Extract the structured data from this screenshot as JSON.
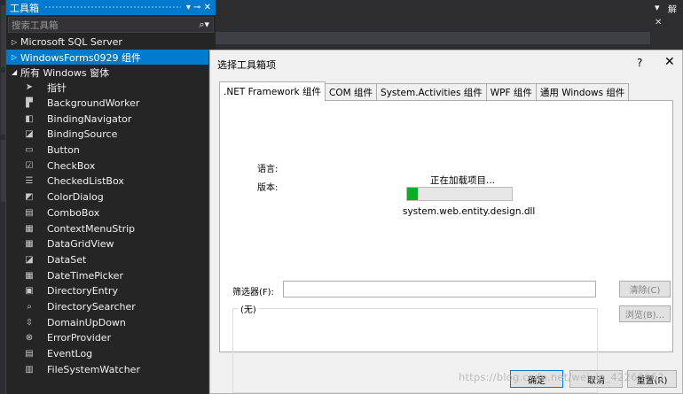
{
  "toolbox": {
    "title": "工具箱",
    "controls": "▾ ⊸ ✕",
    "search_placeholder": "搜索工具箱",
    "search_icon_glyph": "⌕▾",
    "groups": [
      {
        "label": "Microsoft SQL Server",
        "expanded": false,
        "selected": false
      },
      {
        "label": "WindowsForms0929 组件",
        "expanded": false,
        "selected": true
      },
      {
        "label": "所有 Windows 窗体",
        "expanded": true,
        "selected": false
      }
    ],
    "tools": [
      {
        "label": "指针",
        "icon": "pointer-icon"
      },
      {
        "label": "BackgroundWorker",
        "icon": "background-worker-icon"
      },
      {
        "label": "BindingNavigator",
        "icon": "binding-navigator-icon"
      },
      {
        "label": "BindingSource",
        "icon": "binding-source-icon"
      },
      {
        "label": "Button",
        "icon": "button-icon"
      },
      {
        "label": "CheckBox",
        "icon": "checkbox-icon"
      },
      {
        "label": "CheckedListBox",
        "icon": "checked-listbox-icon"
      },
      {
        "label": "ColorDialog",
        "icon": "color-dialog-icon"
      },
      {
        "label": "ComboBox",
        "icon": "combobox-icon"
      },
      {
        "label": "ContextMenuStrip",
        "icon": "context-menu-strip-icon"
      },
      {
        "label": "DataGridView",
        "icon": "data-grid-view-icon"
      },
      {
        "label": "DataSet",
        "icon": "dataset-icon"
      },
      {
        "label": "DateTimePicker",
        "icon": "date-time-picker-icon"
      },
      {
        "label": "DirectoryEntry",
        "icon": "directory-entry-icon"
      },
      {
        "label": "DirectorySearcher",
        "icon": "directory-searcher-icon"
      },
      {
        "label": "DomainUpDown",
        "icon": "domain-up-down-icon"
      },
      {
        "label": "ErrorProvider",
        "icon": "error-provider-icon"
      },
      {
        "label": "EventLog",
        "icon": "event-log-icon"
      },
      {
        "label": "FileSystemWatcher",
        "icon": "file-system-watcher-icon"
      }
    ]
  },
  "right_panel": {
    "header": "▾",
    "header2": "解",
    "close": "✕"
  },
  "dialog": {
    "title": "选择工具箱项",
    "help": "?",
    "close": "✕",
    "tabs": [
      {
        "label": ".NET Framework 组件",
        "active": true
      },
      {
        "label": "COM 组件",
        "active": false
      },
      {
        "label": "System.Activities 组件",
        "active": false
      },
      {
        "label": "WPF 组件",
        "active": false
      },
      {
        "label": "通用 Windows 组件",
        "active": false
      }
    ],
    "loading_text": "正在加载项目...",
    "progress_fraction": 0.1,
    "current_file": "system.web.entity.design.dll",
    "filter_label": "筛选器(F):",
    "filter_value": "",
    "clear_label": "清除(C)",
    "browse_label": "浏览(B)...",
    "info_legend": "(无)",
    "language_label": "语言:",
    "version_label": "版本:",
    "ok_label": "确定",
    "cancel_label": "取消",
    "reset_label": "重置(R)"
  },
  "watermark": "https://blog.csdn.net/weixin_42263063",
  "colors": {
    "accent": "#007acc",
    "progress": "#06b025"
  }
}
